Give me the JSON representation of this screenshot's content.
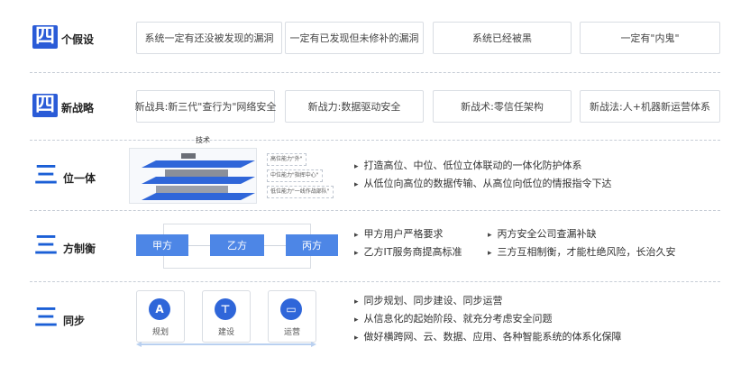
{
  "sections": {
    "assumptions": {
      "big": "四",
      "small": "个假设",
      "cards": [
        "系统一定有还没被发现的漏洞",
        "一定有已发现但未修补的漏洞",
        "系统已经被黑",
        "一定有\"内鬼\""
      ]
    },
    "strategy": {
      "big": "四",
      "small": "新战略",
      "cards": [
        "新战具:新三代\"查行为\"网络安全",
        "新战力:数据驱动安全",
        "新战术:零信任架构",
        "新战法:人+机器新运营体系"
      ]
    },
    "unity": {
      "big": "三",
      "small": "位一体",
      "diagram_label": "技术",
      "layer_tags": [
        "高位能力\"外\"",
        "中位能力\"指挥中心\"",
        "低位能力\"一线作战部队\""
      ],
      "bullets": [
        "打造高位、中位、低位立体联动的一体化防护体系",
        "从低位向高位的数据传输、从高位向低位的情报指令下达"
      ]
    },
    "parties": {
      "big": "三",
      "small": "方制衡",
      "boxes": [
        "甲方",
        "乙方",
        "丙方"
      ],
      "bullets_left": [
        "甲方用户严格要求",
        "乙方IT服务商提高标准"
      ],
      "bullets_right": [
        "丙方安全公司查漏补缺",
        "三方互相制衡，才能杜绝风险，长治久安"
      ]
    },
    "sync": {
      "big": "三",
      "small": "同步",
      "items": [
        {
          "label": "规划",
          "icon": "compass-icon"
        },
        {
          "label": "建设",
          "icon": "crane-icon"
        },
        {
          "label": "运营",
          "icon": "chat-icon"
        }
      ],
      "bullets": [
        "同步规划、同步建设、同步运营",
        "从信息化的起始阶段、就充分考虑安全问题",
        "做好横跨网、云、数据、应用、各种智能系统的体系化保障"
      ]
    }
  },
  "colors": {
    "accent": "#2a5bd7",
    "box": "#4d86e6"
  }
}
